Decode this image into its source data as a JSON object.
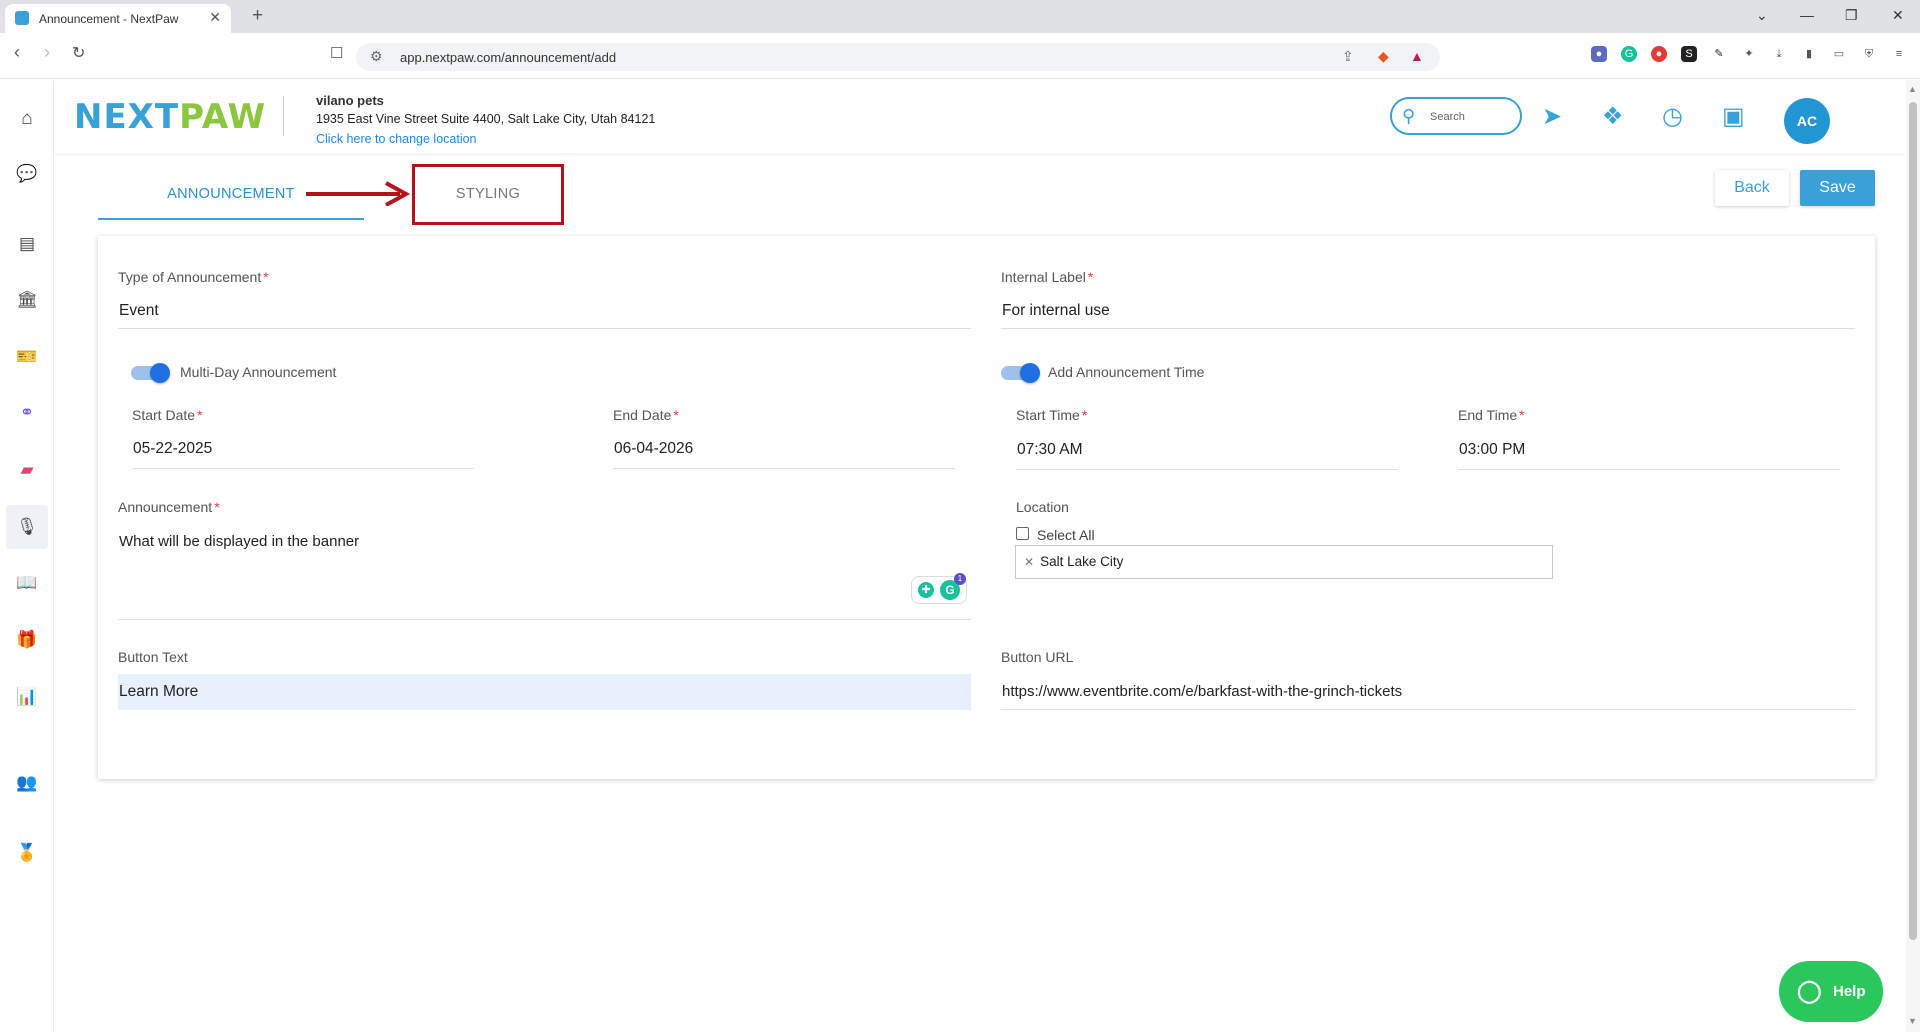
{
  "browser": {
    "tab_title": "Announcement - NextPaw",
    "url": "app.nextpaw.com/announcement/add"
  },
  "header": {
    "logo_next": "NEXT",
    "logo_paw": "PAW",
    "business_name": "vilano pets",
    "business_address": "1935 East Vine Street Suite 4400, Salt Lake City, Utah 84121",
    "change_location_link": "Click here to change location",
    "search_placeholder": "Search",
    "avatar_initials": "AC"
  },
  "tabs": {
    "announcement": "ANNOUNCEMENT",
    "styling": "STYLING"
  },
  "actions": {
    "back": "Back",
    "save": "Save"
  },
  "form": {
    "type_label": "Type of Announcement",
    "type_value": "Event",
    "internal_label_label": "Internal Label",
    "internal_label_value": "For internal use",
    "multi_day_label": "Multi-Day Announcement",
    "multi_day_on": true,
    "add_time_label": "Add Announcement Time",
    "add_time_on": true,
    "start_date_label": "Start Date",
    "start_date_value": "05-22-2025",
    "end_date_label": "End Date",
    "end_date_value": "06-04-2026",
    "start_time_label": "Start Time",
    "start_time_value": "07:30 AM",
    "end_time_label": "End Time",
    "end_time_value": "03:00 PM",
    "announcement_label": "Announcement",
    "announcement_value": "What will be displayed in the banner",
    "location_label": "Location",
    "select_all_label": "Select All",
    "location_chip": "Salt Lake City",
    "button_text_label": "Button Text",
    "button_text_value": "Learn More",
    "button_url_label": "Button URL",
    "button_url_value": "https://www.eventbrite.com/e/barkfast-with-the-grinch-tickets",
    "required_mark": "*",
    "grammarly_badge": "1"
  },
  "help": {
    "label": "Help"
  },
  "colors": {
    "brand_blue": "#3aa0d8",
    "brand_green": "#8cc63f",
    "highlight_red": "#b5121b",
    "help_green": "#2bc75d"
  },
  "icons": {
    "sidebar": [
      "home-icon",
      "chat-icon",
      "document-icon",
      "building-icon",
      "ticket-icon",
      "link-icon",
      "eraser-icon",
      "microphone-icon",
      "book-icon",
      "gift-icon",
      "analytics-icon",
      "users-icon",
      "award-icon"
    ],
    "header": [
      "search-icon",
      "send-icon",
      "rewards-icon",
      "clock-icon",
      "bill-icon"
    ]
  }
}
